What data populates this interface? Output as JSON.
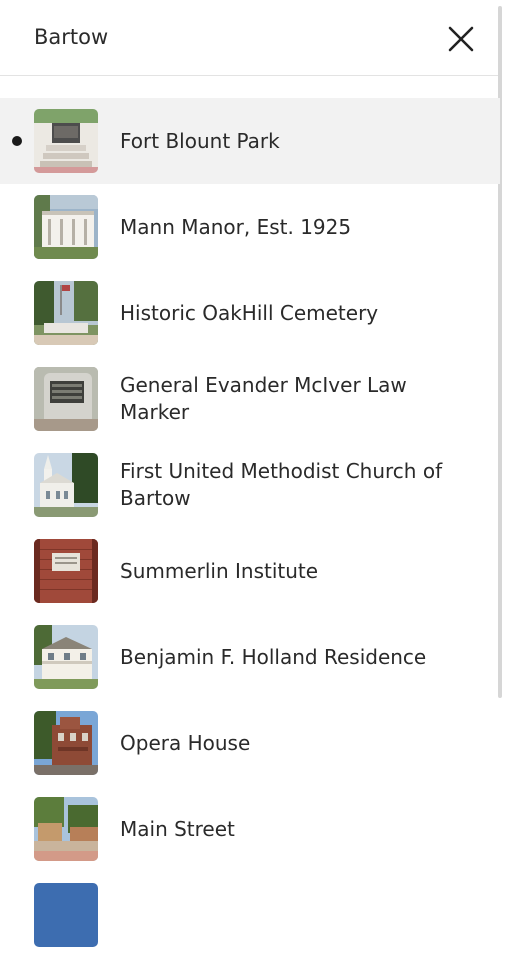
{
  "header": {
    "title": "Bartow"
  },
  "close_icon": "close-icon",
  "places": [
    {
      "name": "Fort Blount Park",
      "selected": true
    },
    {
      "name": "Mann Manor, Est. 1925",
      "selected": false
    },
    {
      "name": "Historic OakHill Cemetery",
      "selected": false
    },
    {
      "name": "General Evander McIver Law Marker",
      "selected": false
    },
    {
      "name": "First United Methodist Church of Bartow",
      "selected": false
    },
    {
      "name": "Summerlin Institute",
      "selected": false
    },
    {
      "name": "Benjamin F. Holland Residence",
      "selected": false
    },
    {
      "name": "Opera House",
      "selected": false
    },
    {
      "name": "Main Street",
      "selected": false
    }
  ]
}
